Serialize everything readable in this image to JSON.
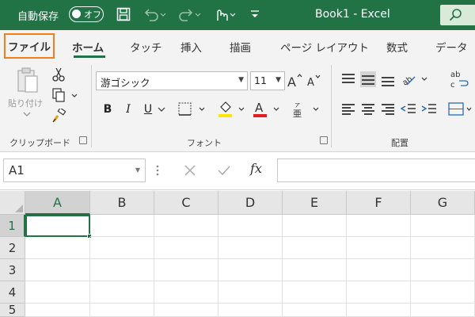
{
  "title_bar": {
    "autosave_label": "自動保存",
    "autosave_toggle": "オフ",
    "document_title": "Book1  -  Excel",
    "icons": [
      "save-icon",
      "undo-icon",
      "redo-icon",
      "touch-mode-icon",
      "customize-qat-icon",
      "search-icon"
    ]
  },
  "tabs": {
    "file": "ファイル",
    "home": "ホーム",
    "touch": "タッチ",
    "insert": "挿入",
    "draw": "描画",
    "page_layout": "ページ レイアウト",
    "formulas": "数式",
    "data": "データ"
  },
  "ribbon": {
    "clipboard": {
      "paste_label": "貼り付け",
      "group_label": "クリップボード"
    },
    "font": {
      "font_name": "游ゴシック",
      "font_size": "11",
      "bold": "B",
      "italic": "I",
      "underline": "U",
      "group_label": "フォント"
    },
    "alignment": {
      "group_label": "配置"
    }
  },
  "formula_bar": {
    "name_box": "A1",
    "fx_label": "fx",
    "formula_value": ""
  },
  "grid": {
    "columns": [
      "A",
      "B",
      "C",
      "D",
      "E",
      "F",
      "G"
    ],
    "rows": [
      "1",
      "2",
      "3",
      "4",
      "5"
    ],
    "active_cell": "A1"
  },
  "colors": {
    "title_bar": "#217346",
    "file_highlight": "#f07f1e",
    "font_color_bar": "#e02020",
    "highlight_color_bar": "#ffe600"
  }
}
